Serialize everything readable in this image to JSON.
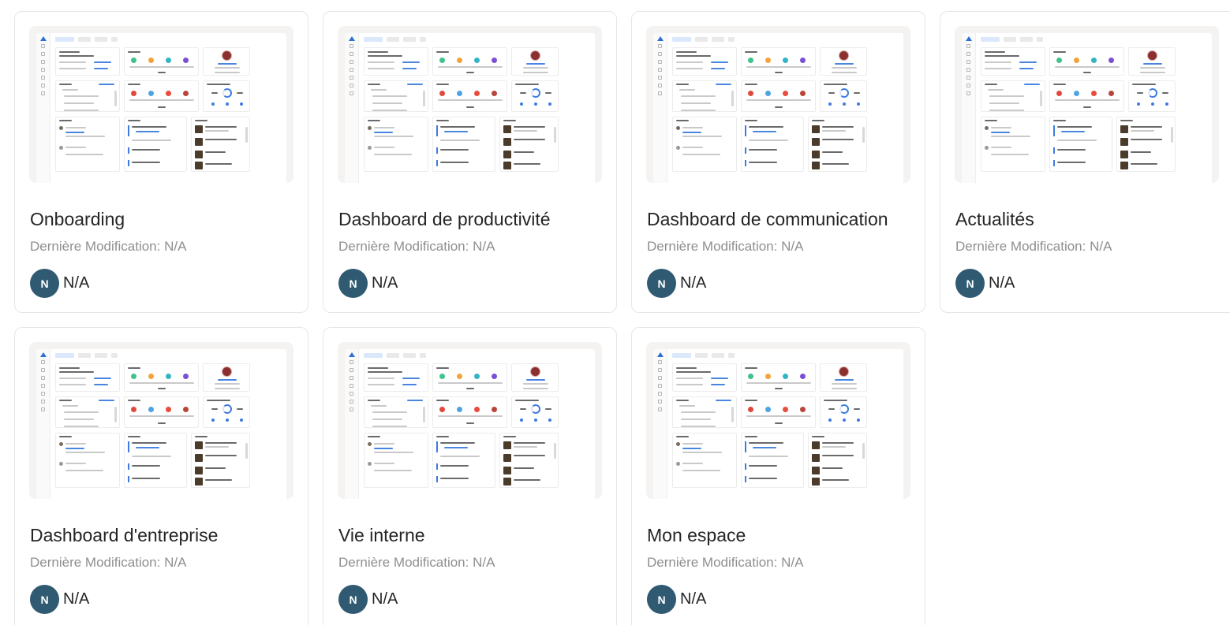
{
  "colors": {
    "avatar_bg": "#2f5a72",
    "thumb_bg": "#f4f3f1",
    "card_border": "#e6e6e6"
  },
  "cards": [
    {
      "title": "Onboarding",
      "modified": "Dernière Modification: N/A",
      "avatar": "N",
      "owner": "N/A"
    },
    {
      "title": "Dashboard de productivité",
      "modified": "Dernière Modification: N/A",
      "avatar": "N",
      "owner": "N/A"
    },
    {
      "title": "Dashboard de communication",
      "modified": "Dernière Modification: N/A",
      "avatar": "N",
      "owner": "N/A"
    },
    {
      "title": "Actualités",
      "modified": "Dernière Modification: N/A",
      "avatar": "N",
      "owner": "N/A"
    },
    {
      "title": "Dashboard d'entreprise",
      "modified": "Dernière Modification: N/A",
      "avatar": "N",
      "owner": "N/A"
    },
    {
      "title": "Vie interne",
      "modified": "Dernière Modification: N/A",
      "avatar": "N",
      "owner": "N/A"
    },
    {
      "title": "Mon espace",
      "modified": "Dernière Modification: N/A",
      "avatar": "N",
      "owner": "N/A"
    }
  ]
}
